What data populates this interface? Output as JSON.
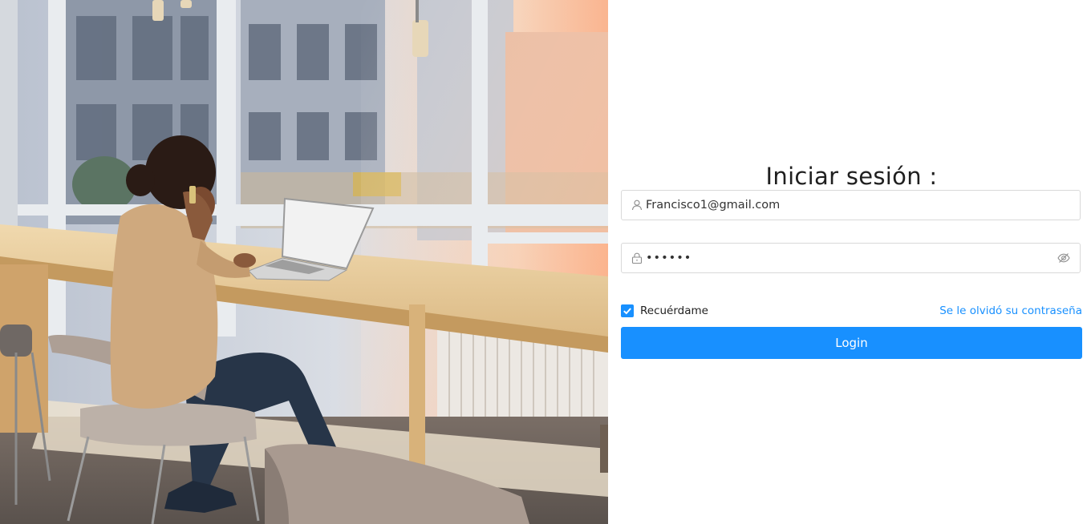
{
  "login": {
    "title": "Iniciar sesión :",
    "username_value": "Francisco1@gmail.com",
    "password_value": "••••••",
    "remember_label": "Recuérdame",
    "remember_checked": true,
    "forgot_label": "Se le olvidó su contraseña",
    "button_label": "Login"
  },
  "icons": {
    "user": "user-icon",
    "lock": "lock-icon",
    "password_visibility": "eye-invisible-icon",
    "checkbox": "checkmark-icon"
  },
  "colors": {
    "primary": "#1890ff",
    "border": "#d9d9d9",
    "title": "#1f1f1f"
  }
}
